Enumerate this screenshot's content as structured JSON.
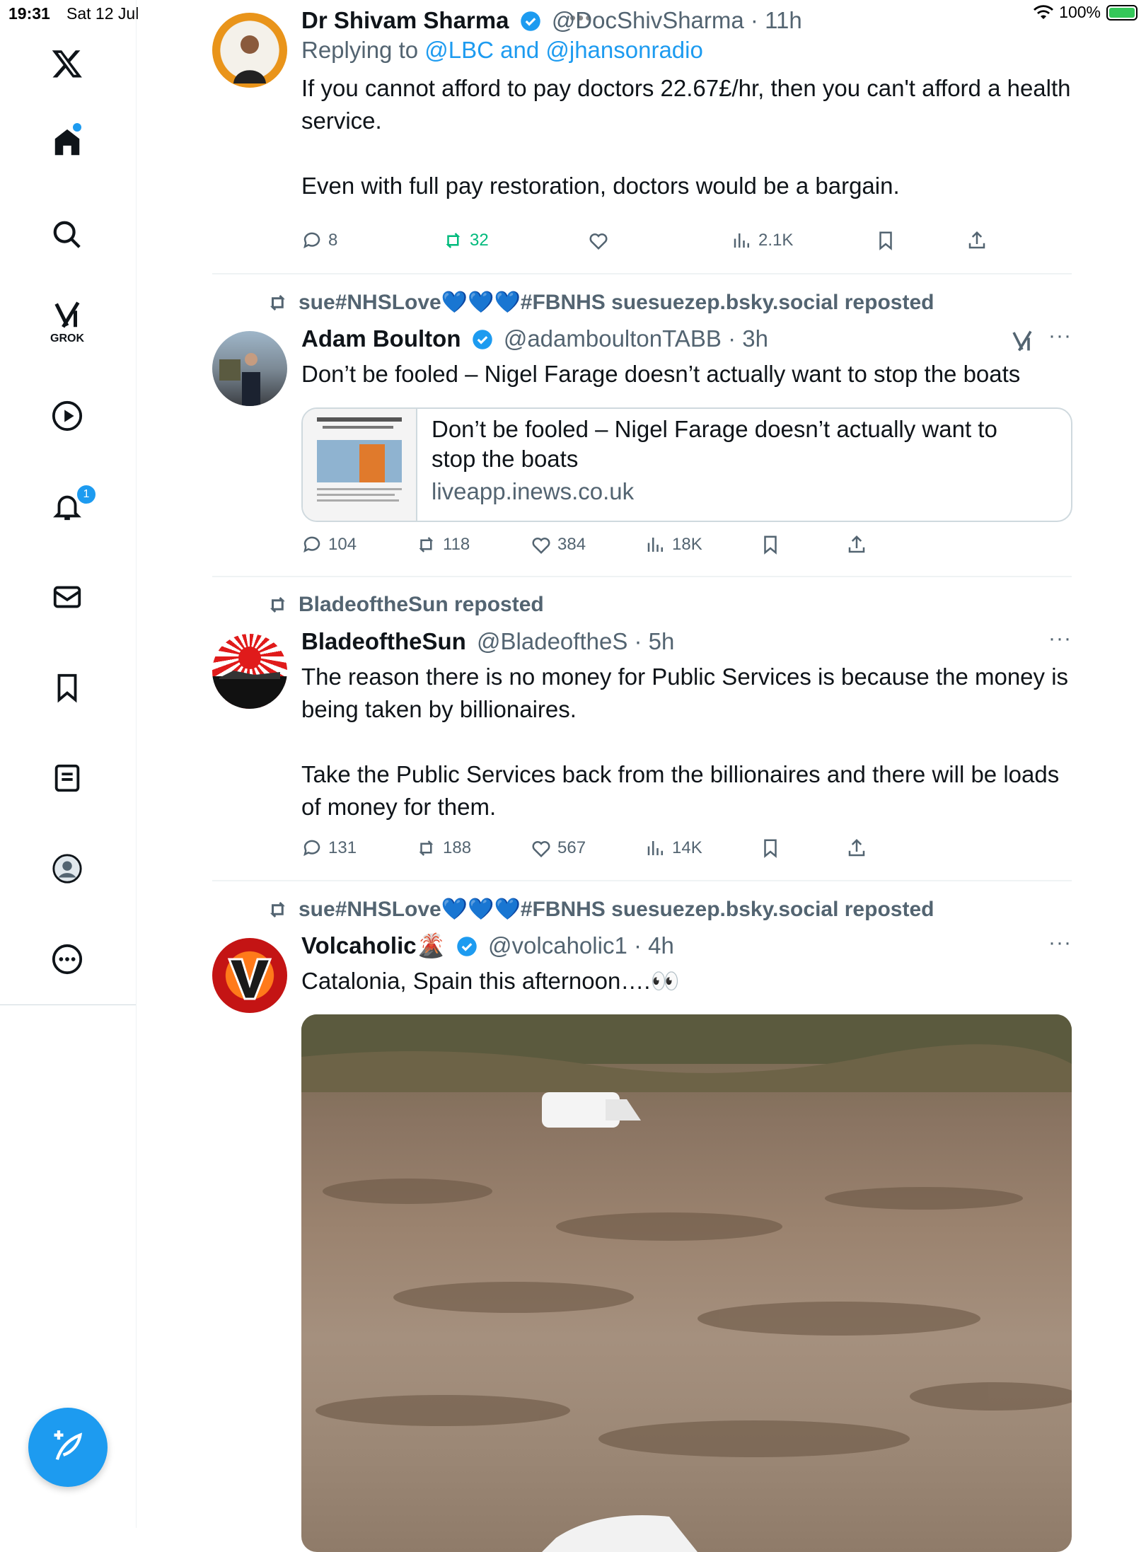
{
  "status_bar": {
    "time": "19:31",
    "date": "Sat 12 Jul",
    "battery": "100%"
  },
  "sidebar": {
    "logo": "x-logo-icon",
    "items": [
      {
        "icon": "home-icon",
        "label": ""
      },
      {
        "icon": "search-icon",
        "label": ""
      },
      {
        "icon": "grok-icon",
        "label": "GROK"
      },
      {
        "icon": "video-play-icon",
        "label": ""
      },
      {
        "icon": "bell-icon",
        "label": "",
        "badge": "1"
      },
      {
        "icon": "mail-icon",
        "label": ""
      },
      {
        "icon": "bookmark-icon",
        "label": ""
      },
      {
        "icon": "list-icon",
        "label": ""
      },
      {
        "icon": "profile-icon",
        "label": ""
      },
      {
        "icon": "more-icon",
        "label": ""
      }
    ],
    "compose_icon": "compose-icon",
    "accent": "#1d9bf0"
  },
  "tweets": [
    {
      "name": "Dr Shivam Sharma",
      "handle": "@DocShivSharma",
      "time": "· 11h",
      "reply_prefix": "Replying to",
      "reply_to": "@LBC and @jhansonradio",
      "text": "If you cannot afford to pay doctors 22.67£/hr, then you can't afford a health service.\n\nEven with full pay restoration, doctors would be a bargain.",
      "replies": "8",
      "reposts": "32",
      "likes": "",
      "views": "2.1K"
    },
    {
      "repost_by": "sue#NHSLove💙💙💙#FBNHS suesuezep.bsky.social reposted",
      "name": "Adam Boulton",
      "handle": "@adamboultonTABB",
      "time": "· 3h",
      "text": "Don’t be fooled – Nigel Farage doesn’t actually want to stop the boats",
      "card_title": "Don’t be fooled – Nigel Farage doesn’t actually want to stop the boats",
      "card_domain": "liveapp.inews.co.uk",
      "replies": "104",
      "reposts": "118",
      "likes": "384",
      "views": "18K"
    },
    {
      "repost_by": "BladeoftheSun reposted",
      "name": "BladeoftheSun",
      "handle": "@BladeoftheS",
      "time": "· 5h",
      "text": "The reason there is no money for Public Services is because the money is being taken by billionaires.\n\nTake the Public Services back from the billionaires and there will be loads of money for them.",
      "replies": "131",
      "reposts": "188",
      "likes": "567",
      "views": "14K"
    },
    {
      "repost_by": "sue#NHSLove💙💙💙#FBNHS suesuezep.bsky.social reposted",
      "name": "Volcaholic🌋",
      "handle": "@volcaholic1",
      "time": "· 4h",
      "text": "Catalonia, Spain this afternoon….👀"
    }
  ]
}
